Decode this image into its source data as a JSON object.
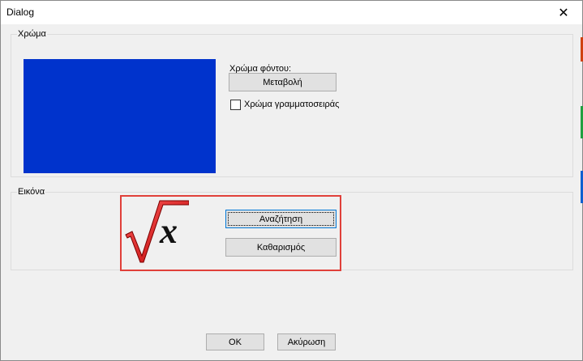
{
  "window": {
    "title": "Dialog",
    "close_glyph": "✕",
    "accents": [
      "#d04010",
      "#20a040",
      "#1060d0"
    ]
  },
  "color_group": {
    "label": "Χρώμα",
    "swatch_color": "#0033cc",
    "background_color_label": "Χρώμα φόντου:",
    "change_button": "Μεταβολή",
    "font_color_checkbox": {
      "label": "Χρώμα γραμματοσειράς",
      "checked": false
    }
  },
  "image_group": {
    "label": "Εικόνα",
    "icon": "square-root-x-icon",
    "search_button": "Αναζήτηση",
    "clear_button": "Καθαρισμός",
    "highlight_color": "#e0403a"
  },
  "footer": {
    "ok_button": "OK",
    "cancel_button": "Ακύρωση"
  }
}
